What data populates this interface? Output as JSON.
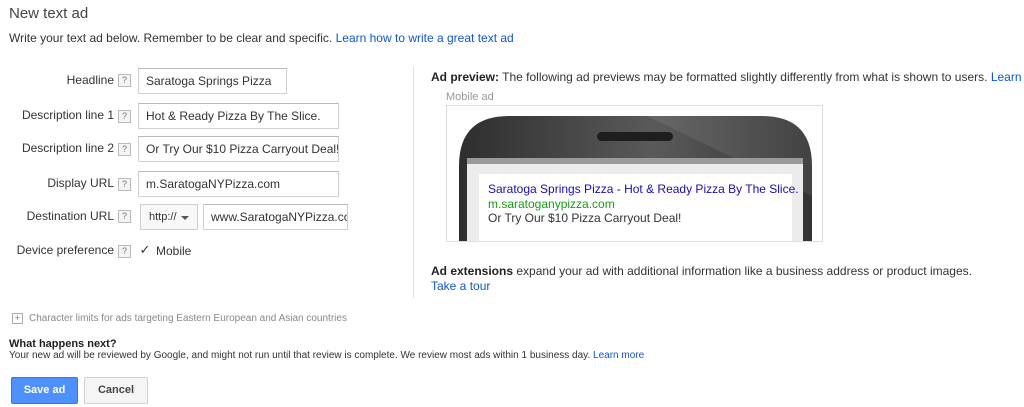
{
  "header": {
    "title": "New text ad",
    "intro": "Write your text ad below. Remember to be clear and specific.",
    "intro_link": "Learn how to write a great text ad"
  },
  "form": {
    "help_glyph": "?",
    "headline": {
      "label": "Headline",
      "value": "Saratoga Springs Pizza"
    },
    "description1": {
      "label": "Description line 1",
      "value": "Hot & Ready Pizza By The Slice."
    },
    "description2": {
      "label": "Description line 2",
      "value": "Or Try Our $10 Pizza Carryout Deal!"
    },
    "display_url": {
      "label": "Display URL",
      "value": "m.SaratogaNYPizza.com"
    },
    "destination_url": {
      "label": "Destination URL",
      "protocol": "http://",
      "value": "www.SaratogaNYPizza.com"
    },
    "device_preference": {
      "label": "Device preference",
      "option": "Mobile",
      "checked": true,
      "check_glyph": "✓"
    }
  },
  "preview": {
    "heading_bold": "Ad preview:",
    "heading_text": "The following ad previews may be formatted slightly differently from what is shown to users.",
    "learn_more": "Learn more",
    "mobile_label": "Mobile ad",
    "ad": {
      "headline": "Saratoga Springs Pizza - Hot & Ready Pizza By The Slice.",
      "url": "m.saratoganypizza.com",
      "description": "Or Try Our $10 Pizza Carryout Deal!"
    },
    "colors": {
      "ad_link": "#1a0dab",
      "ad_url": "#1a9a1a",
      "phone_body": "#4a4a4a"
    }
  },
  "extensions": {
    "bold": "Ad extensions",
    "text": "expand your ad with additional information like a business address or product images.",
    "tour_link": "Take a tour"
  },
  "char_limits": {
    "expand_glyph": "+",
    "text": "Character limits for ads targeting Eastern European and Asian countries"
  },
  "next": {
    "heading": "What happens next?",
    "text": "Your new ad will be reviewed by Google, and might not run until that review is complete. We review most ads within 1 business day.",
    "link": "Learn more"
  },
  "actions": {
    "save": "Save ad",
    "cancel": "Cancel"
  }
}
